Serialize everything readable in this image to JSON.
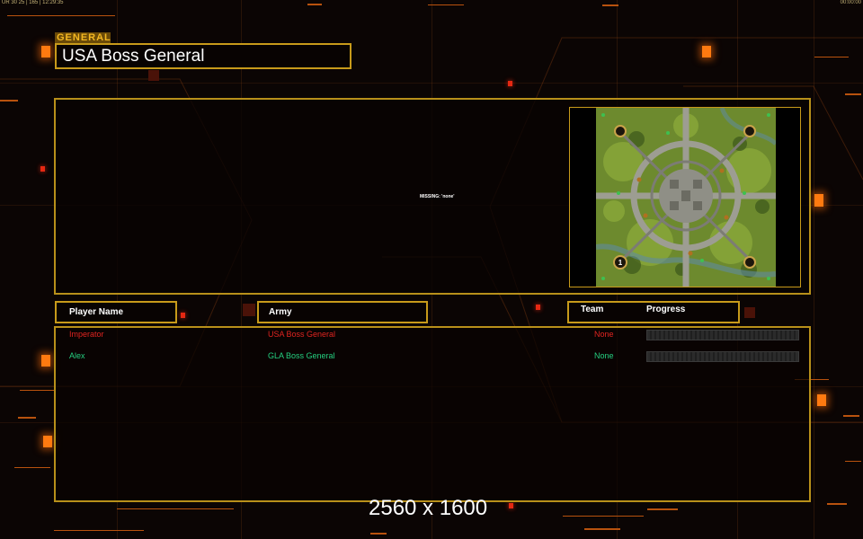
{
  "status_bar": {
    "left_text": "UR 30 25 | 165 | 12:29:35",
    "right_text": "00:00:00"
  },
  "general": {
    "tag": "GENERAL",
    "name": "USA Boss General"
  },
  "map": {
    "missing_text": "MISSING: 'none'",
    "start_positions": [
      "1"
    ]
  },
  "headers": {
    "player_name": "Player Name",
    "army": "Army",
    "team": "Team",
    "progress": "Progress"
  },
  "players": [
    {
      "name": "Imperator",
      "army": "USA Boss General",
      "team": "None",
      "color": "#e02420",
      "progress": 0
    },
    {
      "name": "Alex",
      "army": "GLA Boss General",
      "team": "None",
      "color": "#25d080",
      "progress": 0
    }
  ],
  "resolution_label": "2560 x 1600",
  "colors": {
    "accent": "#c79a1a",
    "glow": "#ff7a10"
  },
  "icons": [
    "map-preview-icon",
    "start-position-icon"
  ]
}
